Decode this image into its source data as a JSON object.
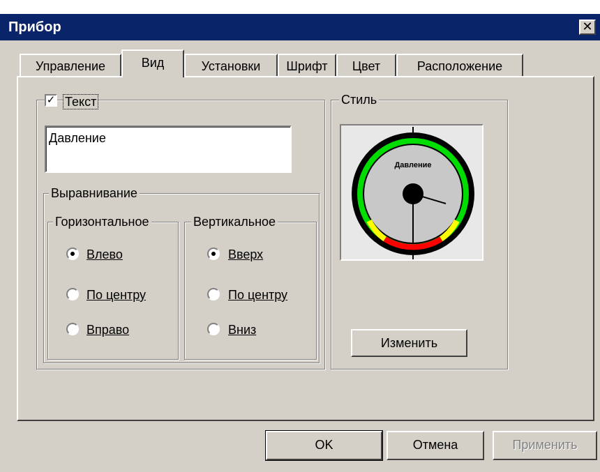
{
  "window": {
    "title": "Прибор",
    "close_glyph": "✕"
  },
  "tabs": [
    {
      "label": "Управление",
      "active": false
    },
    {
      "label": "Вид",
      "active": true
    },
    {
      "label": "Установки",
      "active": false
    },
    {
      "label": "Шрифт",
      "active": false
    },
    {
      "label": "Цвет",
      "active": false
    },
    {
      "label": "Расположение",
      "active": false
    }
  ],
  "text_group": {
    "checkbox_label": "Текст",
    "checked": true,
    "value": "Давление"
  },
  "alignment": {
    "title": "Выравнивание",
    "horizontal": {
      "title": "Горизонтальное",
      "options": [
        "Влево",
        "По центру",
        "Вправо"
      ],
      "selected": 0
    },
    "vertical": {
      "title": "Вертикальное",
      "options": [
        "Вверх",
        "По центру",
        "Вниз"
      ],
      "selected": 0
    }
  },
  "style_group": {
    "title": "Стиль",
    "gauge_label": "Давление",
    "change_button": "Изменить"
  },
  "buttons": {
    "ok": "OK",
    "cancel": "Отмена",
    "apply": "Применить"
  },
  "colors": {
    "title_bar": "#0a246a",
    "face": "#d4d0c8",
    "green": "#00dd00",
    "yellow": "#ffff00",
    "red": "#ff0000"
  }
}
